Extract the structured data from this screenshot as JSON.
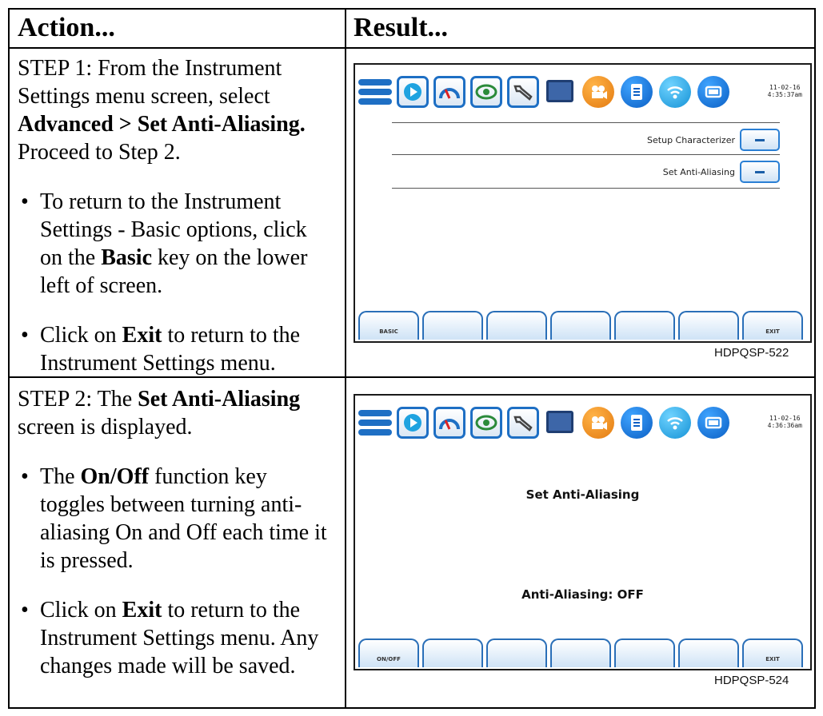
{
  "table": {
    "header_action": "Action...",
    "header_result": "Result..."
  },
  "step1": {
    "line1": "STEP 1: From the Instrument",
    "line2": "Settings menu screen, select",
    "line3_bold": "Advanced > Set Anti-Aliasing.",
    "line4": "Proceed to Step 2.",
    "bullet1_a": "To return to the Instrument",
    "bullet1_b": "Settings - Basic options, click",
    "bullet1_c_pre": "on the ",
    "bullet1_c_bold": "Basic",
    "bullet1_c_post": " key on the lower",
    "bullet1_d": "left of screen.",
    "bullet2_pre": "Click on ",
    "bullet2_bold": "Exit",
    "bullet2_post": " to return to the",
    "bullet2_b": "Instrument Settings menu."
  },
  "step2": {
    "line1_pre": "STEP 2: The ",
    "line1_bold": "Set Anti-Aliasing",
    "line2": "screen is displayed.",
    "bullet1_pre": "The ",
    "bullet1_bold": "On/Off",
    "bullet1_post": " function key",
    "bullet1_b": "toggles between turning anti-",
    "bullet1_c": "aliasing On and Off each time it",
    "bullet1_d": "is pressed.",
    "bullet2_pre": "Click on ",
    "bullet2_bold": "Exit",
    "bullet2_post": " to return to the",
    "bullet2_b": "Instrument Settings menu. Any",
    "bullet2_c": "changes made will be saved."
  },
  "screen1": {
    "date": "11-02-16",
    "time": "4:35:37am",
    "row1_label": "Setup Characterizer",
    "row2_label": "Set Anti-Aliasing",
    "fkey_left": "BASIC",
    "fkey_right": "EXIT",
    "caption": "HDPQSP-522"
  },
  "screen2": {
    "date": "11-02-16",
    "time": "4:36:36am",
    "title": "Set Anti-Aliasing",
    "status": "Anti-Aliasing: OFF",
    "fkey_left": "ON/OFF",
    "fkey_right": "EXIT",
    "caption": "HDPQSP-524"
  },
  "icons": [
    "menu-icon",
    "play-icon",
    "gauge-icon",
    "eye-icon",
    "wrench-icon",
    "monitor-icon",
    "camera-icon",
    "document-icon",
    "wifi-icon",
    "battery-icon"
  ],
  "colors": {
    "accent_blue": "#1e6fc4",
    "orange": "#f08a1c"
  }
}
